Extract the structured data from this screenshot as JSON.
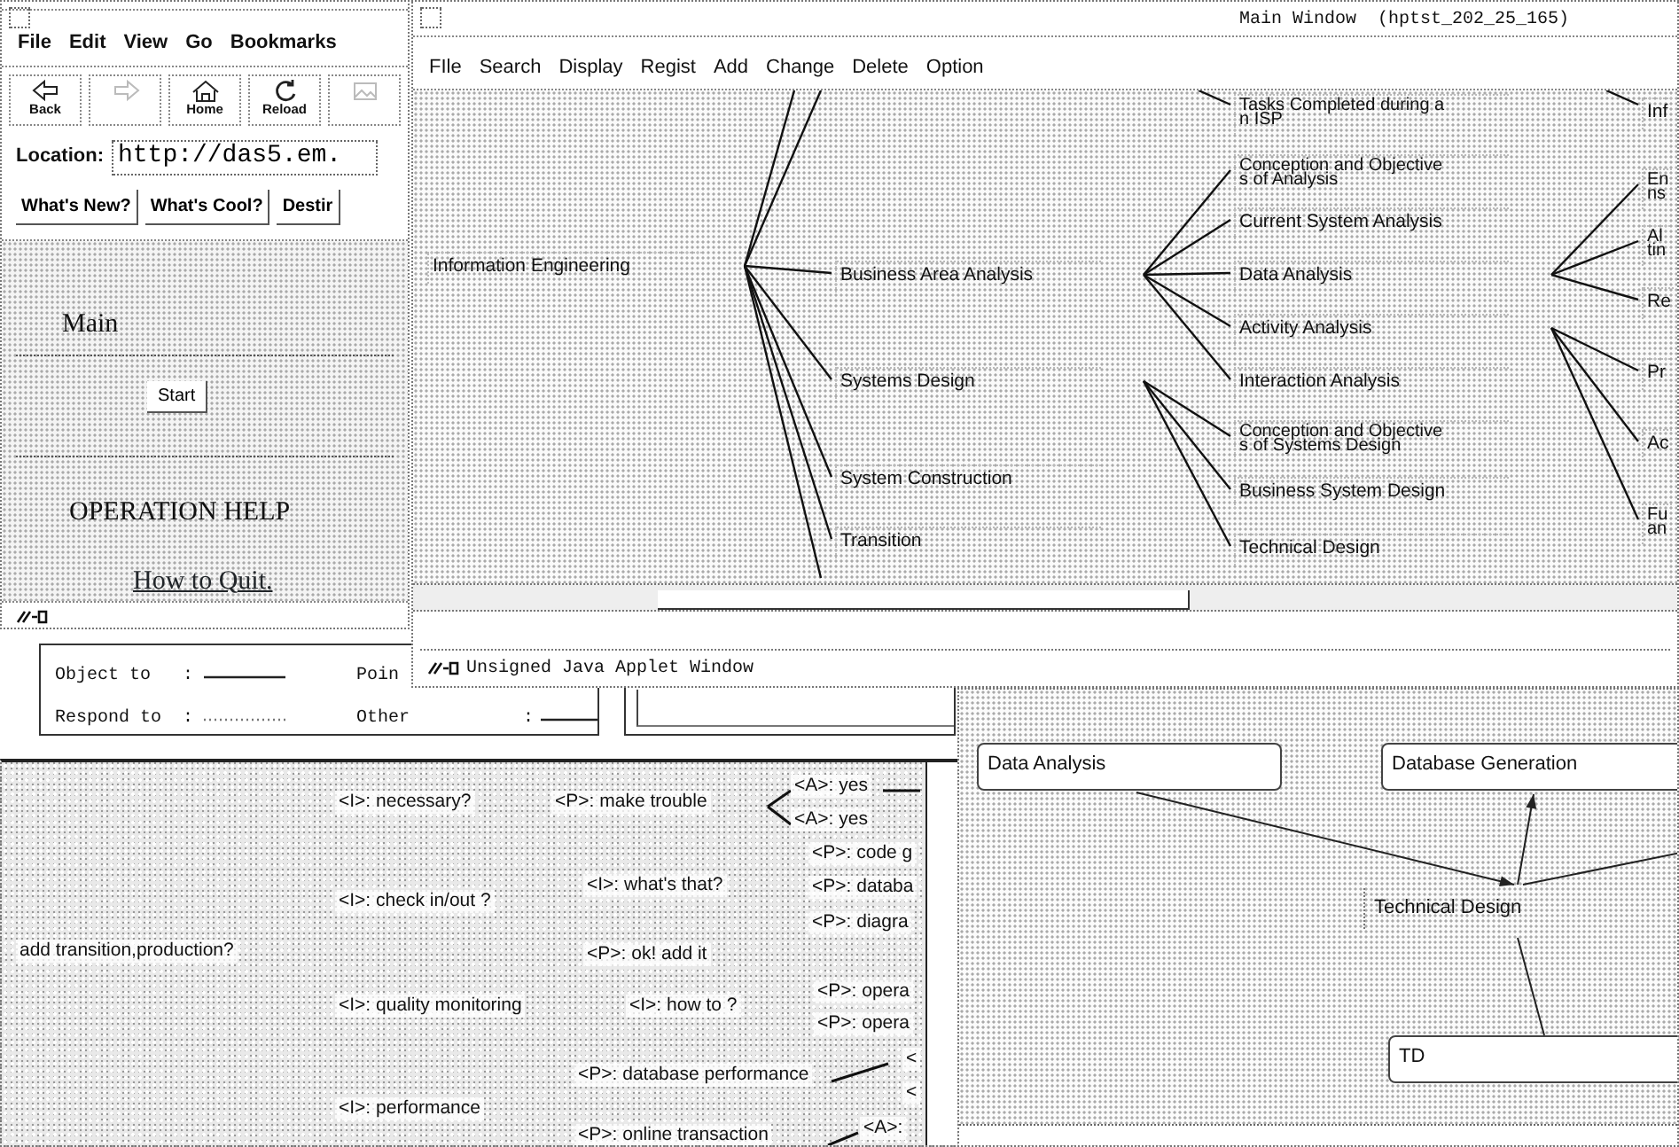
{
  "browser_window": {
    "menu": [
      "File",
      "Edit",
      "View",
      "Go",
      "Bookmarks"
    ],
    "toolbar": [
      {
        "kind": "back",
        "label": "Back",
        "disabled": false
      },
      {
        "kind": "forward",
        "disabled": true
      },
      {
        "kind": "home",
        "label": "Home",
        "disabled": false
      },
      {
        "kind": "reload",
        "label": "Reload",
        "disabled": false
      },
      {
        "kind": "images",
        "disabled": true
      }
    ],
    "location_label": "Location:",
    "location_value": "http://das5.em.",
    "directory_buttons": [
      "What's New?",
      "What's Cool?",
      "Destir"
    ],
    "content": {
      "heading": "Main",
      "start_button": "Start",
      "help_heading": "OPERATION HELP",
      "help_link": "How to Quit."
    }
  },
  "main_window": {
    "title": "Main Window  (hptst_202_25_165)",
    "menu": [
      "FIle",
      "Search",
      "Display",
      "Regist",
      "Add",
      "Change",
      "Delete",
      "Option"
    ],
    "tree": [
      {
        "text": "Information Engineering",
        "children": [
          {
            "text": "Business Area Analysis",
            "children": [
              {
                "text": "Conception and Objective\ns of Analysis"
              },
              {
                "text": "Current System Analysis"
              },
              {
                "text": "Data Analysis",
                "children": [
                  {
                    "text": "En\nns"
                  },
                  {
                    "text": "Al\ntin"
                  },
                  {
                    "text": "Re"
                  }
                ]
              },
              {
                "text": "Activity Analysis",
                "children": [
                  {
                    "text": "Pr"
                  },
                  {
                    "text": "Ac"
                  },
                  {
                    "text": "Fu\nan"
                  }
                ]
              },
              {
                "text": "Interaction Analysis"
              }
            ]
          },
          {
            "text": "Systems Design",
            "children": [
              {
                "text": "Conception and Objective\ns of Systems Design"
              },
              {
                "text": "Business System Design"
              },
              {
                "text": "Technical Design"
              }
            ]
          },
          {
            "text": "System Construction"
          },
          {
            "text": "Transition"
          }
        ]
      },
      {
        "text": "Tasks Completed during a\nn ISP"
      },
      {
        "text": "Inf"
      }
    ],
    "status": "Unsigned Java Applet Window"
  },
  "legend": [
    {
      "label": "Object to",
      "separator": ":",
      "kind": "solid"
    },
    {
      "label": "Poin"
    },
    {
      "label": "Respond to",
      "separator": ":",
      "kind": "dotted"
    },
    {
      "label": "Other",
      "separator": ":",
      "kind": "solid"
    }
  ],
  "question_map": {
    "items": [
      "add transition,production?",
      "<I>: necessary?",
      "<P>: make trouble",
      "<A>: yes",
      "<A>: yes",
      "<P>: code g",
      "<I>: what's that?",
      "<P>: databa",
      "<I>: check in/out ?",
      "<P>: diagra",
      "<P>: ok! add it",
      "<P>: opera",
      "<I>: quality monitoring",
      "<I>: how to ?",
      "<P>: opera",
      "<P>: database performance",
      "<",
      "<",
      "<I>: performance",
      "<A>:",
      "<P>: online transaction"
    ]
  },
  "relation_diagram": {
    "nodes": [
      {
        "text": "Data Analysis",
        "kind": "box"
      },
      {
        "text": "Database Generation",
        "kind": "box"
      },
      {
        "text": "Technical Design",
        "kind": "label"
      },
      {
        "text": "TD",
        "kind": "box"
      }
    ]
  }
}
